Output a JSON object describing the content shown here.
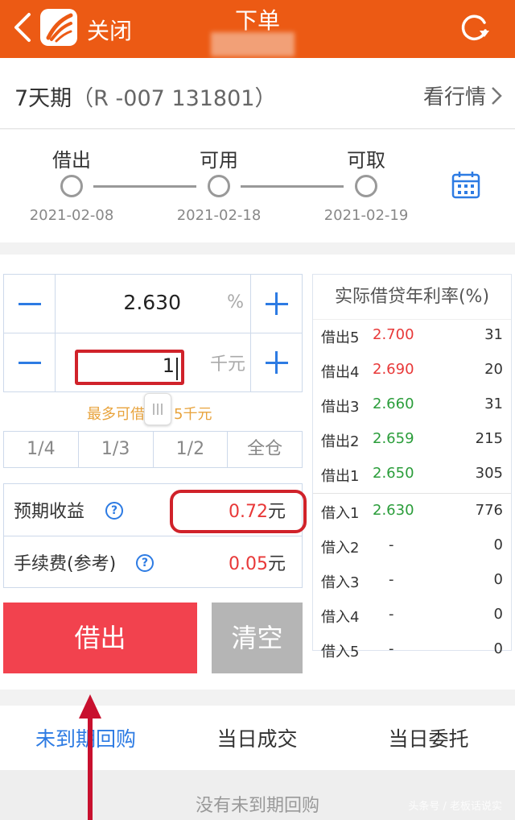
{
  "header": {
    "close_label": "关闭",
    "title": "下单"
  },
  "instrument": {
    "name": "7天期",
    "code": "（R -007 131801）",
    "market_link": "看行情"
  },
  "timeline": {
    "steps": [
      {
        "label": "借出",
        "date": "2021-02-08"
      },
      {
        "label": "可用",
        "date": "2021-02-18"
      },
      {
        "label": "可取",
        "date": "2021-02-19"
      }
    ]
  },
  "form": {
    "rate_value": "2.630",
    "rate_unit": "%",
    "amount_value": "1",
    "amount_unit": "千元",
    "max_hint_left": "最多可借",
    "max_hint_right": "5千元",
    "ratios": [
      "1/4",
      "1/3",
      "1/2",
      "全仓"
    ],
    "expected_profit_label": "预期收益",
    "expected_profit_value": "0.72",
    "fee_label": "手续费(参考)",
    "fee_value": "0.05",
    "currency_unit": "元",
    "help_glyph": "?",
    "lend_button": "借出",
    "clear_button": "清空"
  },
  "orderbook": {
    "title": "实际借贷年利率(%)",
    "rows": [
      {
        "label": "借出5",
        "price": "2.700",
        "volume": "31",
        "color": "#e83838"
      },
      {
        "label": "借出4",
        "price": "2.690",
        "volume": "20",
        "color": "#e83838"
      },
      {
        "label": "借出3",
        "price": "2.660",
        "volume": "31",
        "color": "#2a9d3a"
      },
      {
        "label": "借出2",
        "price": "2.659",
        "volume": "215",
        "color": "#2a9d3a"
      },
      {
        "label": "借出1",
        "price": "2.650",
        "volume": "305",
        "color": "#2a9d3a"
      },
      {
        "label": "借入1",
        "price": "2.630",
        "volume": "776",
        "color": "#2a9d3a"
      },
      {
        "label": "借入2",
        "price": "-",
        "volume": "0",
        "color": "#333333"
      },
      {
        "label": "借入3",
        "price": "-",
        "volume": "0",
        "color": "#333333"
      },
      {
        "label": "借入4",
        "price": "-",
        "volume": "0",
        "color": "#333333"
      },
      {
        "label": "借入5",
        "price": "-",
        "volume": "0",
        "color": "#333333"
      }
    ]
  },
  "tabs": {
    "items": [
      "未到期回购",
      "当日成交",
      "当日委托"
    ],
    "active_index": 0
  },
  "empty_state": "没有未到期回购",
  "watermark": "头条号 / 老板话说实",
  "colors": {
    "header_bg": "#ec5a14",
    "accent_blue": "#2d7be3",
    "lend_red": "#f2424e",
    "highlight_red": "#d0222a"
  }
}
